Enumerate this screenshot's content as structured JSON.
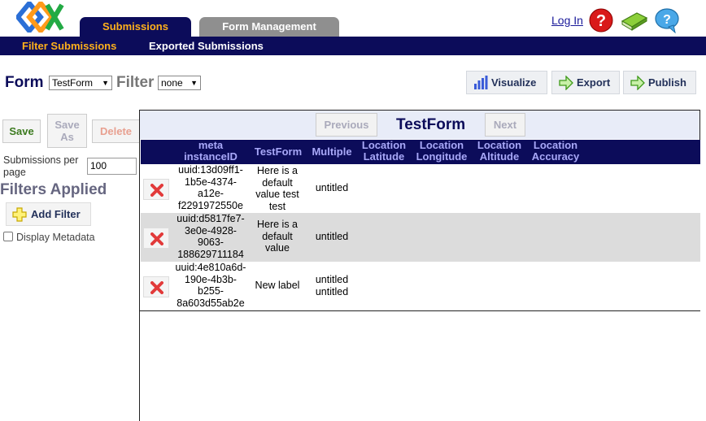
{
  "header": {
    "tabs": [
      {
        "label": "Submissions"
      },
      {
        "label": "Form Management"
      }
    ],
    "login": "Log In",
    "icons": [
      "logo",
      "help-icon",
      "book-icon",
      "chat-bubble-icon"
    ]
  },
  "subnav": {
    "items": [
      {
        "label": "Filter Submissions"
      },
      {
        "label": "Exported Submissions"
      }
    ]
  },
  "toolbar": {
    "form_label": "Form",
    "form_value": "TestForm",
    "filter_label": "Filter",
    "filter_value": "none",
    "visualize": "Visualize",
    "export": "Export",
    "publish": "Publish"
  },
  "left_panel": {
    "save": "Save",
    "save_as_line1": "Save",
    "save_as_line2": "As",
    "delete": "Delete",
    "submissions_per_page": "Submissions per page",
    "submissions_per_page_value": "100",
    "filters_applied": "Filters Applied",
    "add_filter": "Add Filter",
    "display_metadata": "Display Metadata"
  },
  "results": {
    "title": "TestForm",
    "previous": "Previous",
    "next": "Next",
    "columns": [
      {
        "line1": "meta",
        "line2": "instanceID"
      },
      {
        "line1": "TestForm",
        "line2": ""
      },
      {
        "line1": "Multiple",
        "line2": ""
      },
      {
        "line1": "Location",
        "line2": "Latitude"
      },
      {
        "line1": "Location",
        "line2": "Longitude"
      },
      {
        "line1": "Location",
        "line2": "Altitude"
      },
      {
        "line1": "Location",
        "line2": "Accuracy"
      }
    ],
    "rows": [
      {
        "id": [
          "uuid:13d09ff1-",
          "1b5e-4374-",
          "a12e-",
          "f2291972550e"
        ],
        "testform": [
          "Here is a",
          "default",
          "value test",
          "test"
        ],
        "multiple": [
          "untitled"
        ]
      },
      {
        "id": [
          "uuid:d5817fe7-",
          "3e0e-4928-",
          "9063-",
          "188629711184"
        ],
        "testform": [
          "Here is a",
          "default",
          "value"
        ],
        "multiple": [
          "untitled"
        ]
      },
      {
        "id": [
          "uuid:4e810a6d-",
          "190e-4b3b-",
          "b255-",
          "8a603d55ab2e"
        ],
        "testform": [
          "New label"
        ],
        "multiple": [
          "untitled",
          "untitled"
        ]
      }
    ]
  }
}
